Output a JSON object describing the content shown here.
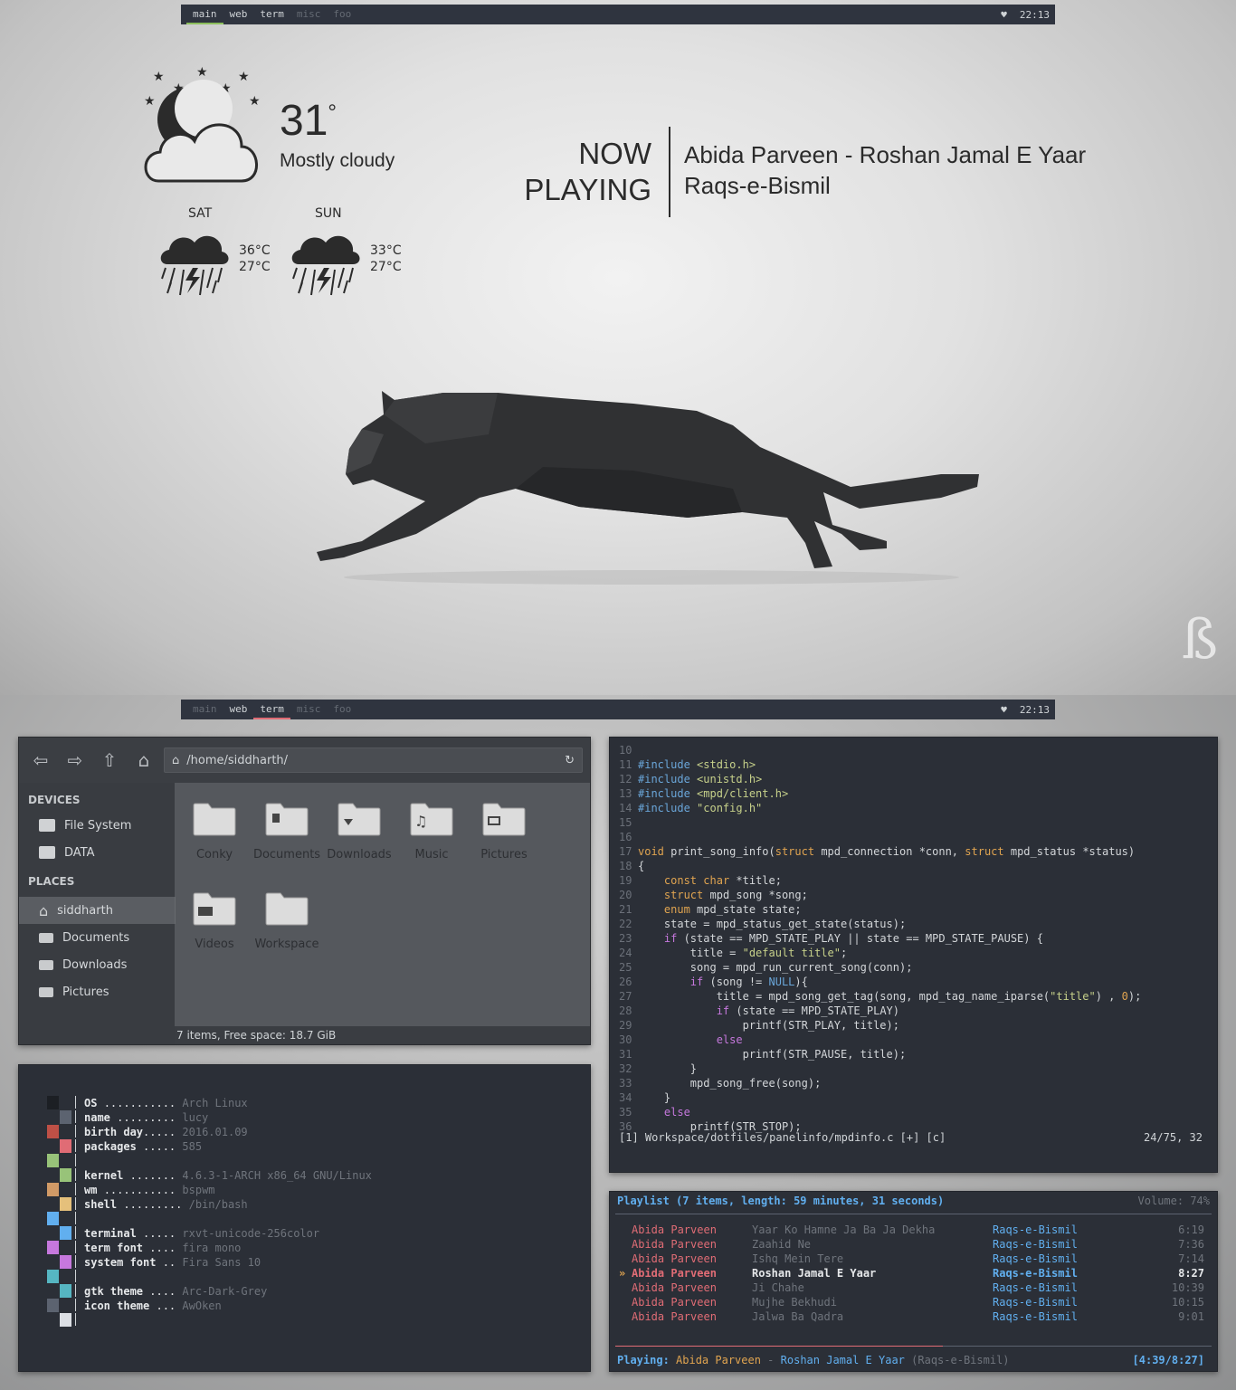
{
  "panel": {
    "workspaces": [
      "main",
      "web",
      "term",
      "misc",
      "foo"
    ],
    "heart_icon": "heart-icon",
    "clock": "22:13",
    "accent_main": "#8cbf5c",
    "accent_term": "#e06c75"
  },
  "weather": {
    "temp": "31",
    "degree": "°",
    "condition": "Mostly cloudy",
    "forecast": [
      {
        "day": "SAT",
        "high": "36°C",
        "low": "27°C",
        "icon": "storm-icon"
      },
      {
        "day": "SUN",
        "high": "33°C",
        "low": "27°C",
        "icon": "storm-icon"
      }
    ]
  },
  "now_playing": {
    "label_line1": "NOW",
    "label_line2": "PLAYING",
    "track": "Abida Parveen - Roshan Jamal E Yaar",
    "album": "Raqs-e-Bismil"
  },
  "file_manager": {
    "path": "/home/siddharth/",
    "devices_header": "DEVICES",
    "devices": [
      "File System",
      "DATA"
    ],
    "places_header": "PLACES",
    "places": [
      "siddharth",
      "Documents",
      "Downloads",
      "Pictures"
    ],
    "folders": [
      "Conky",
      "Documents",
      "Downloads",
      "Music",
      "Pictures",
      "Videos",
      "Workspace"
    ],
    "status": "7 items, Free space: 18.7 GiB"
  },
  "editor": {
    "lines": [
      {
        "n": "10",
        "t": ""
      },
      {
        "n": "11",
        "t": "#include <stdio.h>"
      },
      {
        "n": "12",
        "t": "#include <unistd.h>"
      },
      {
        "n": "13",
        "t": "#include <mpd/client.h>"
      },
      {
        "n": "14",
        "t": "#include \"config.h\""
      },
      {
        "n": "15",
        "t": ""
      },
      {
        "n": "16",
        "t": ""
      },
      {
        "n": "17",
        "t": "void print_song_info(struct mpd_connection *conn, struct mpd_status *status)"
      },
      {
        "n": "18",
        "t": "{"
      },
      {
        "n": "19",
        "t": "    const char *title;"
      },
      {
        "n": "20",
        "t": "    struct mpd_song *song;"
      },
      {
        "n": "21",
        "t": "    enum mpd_state state;"
      },
      {
        "n": "22",
        "t": "    state = mpd_status_get_state(status);"
      },
      {
        "n": "23",
        "t": "    if (state == MPD_STATE_PLAY || state == MPD_STATE_PAUSE) {"
      },
      {
        "n": "24",
        "t": "        title = \"default title\";"
      },
      {
        "n": "25",
        "t": "        song = mpd_run_current_song(conn);"
      },
      {
        "n": "26",
        "t": "        if (song != NULL){"
      },
      {
        "n": "27",
        "t": "            title = mpd_song_get_tag(song, mpd_tag_name_iparse(\"title\") , 0);"
      },
      {
        "n": "28",
        "t": "            if (state == MPD_STATE_PLAY)"
      },
      {
        "n": "29",
        "t": "                printf(STR_PLAY, title);"
      },
      {
        "n": "30",
        "t": "            else"
      },
      {
        "n": "31",
        "t": "                printf(STR_PAUSE, title);"
      },
      {
        "n": "32",
        "t": "        }"
      },
      {
        "n": "33",
        "t": "        mpd_song_free(song);"
      },
      {
        "n": "34",
        "t": "    }"
      },
      {
        "n": "35",
        "t": "    else"
      },
      {
        "n": "36",
        "t": "        printf(STR_STOP);"
      }
    ],
    "statusline_left": "[1] Workspace/dotfiles/panelinfo/mpdinfo.c [+] [c]",
    "statusline_right": "24/75, 32"
  },
  "sysinfo": {
    "rows": [
      {
        "k": "OS ",
        "dots": "........... ",
        "v": "Arch Linux",
        "line": 0
      },
      {
        "k": "name ",
        "dots": "......... ",
        "v": "lucy",
        "line": 1
      },
      {
        "k": "birth day",
        "dots": "..... ",
        "v": "2016.01.09",
        "line": 2
      },
      {
        "k": "packages ",
        "dots": "..... ",
        "v": "585",
        "line": 3
      },
      {
        "k": "kernel ",
        "dots": "....... ",
        "v": "4.6.3-1-ARCH x86_64 GNU/Linux",
        "line": 5
      },
      {
        "k": "wm ",
        "dots": "........... ",
        "v": "bspwm",
        "line": 6
      },
      {
        "k": "shell ",
        "dots": "......... ",
        "v": "/bin/bash",
        "line": 7
      },
      {
        "k": "terminal ",
        "dots": "..... ",
        "v": "rxvt-unicode-256color",
        "line": 9
      },
      {
        "k": "term font ",
        "dots": ".... ",
        "v": "fira mono",
        "line": 10
      },
      {
        "k": "system font ",
        "dots": ".. ",
        "v": "Fira Sans 10",
        "line": 11
      },
      {
        "k": "gtk theme ",
        "dots": ".... ",
        "v": "Arc-Dark-Grey",
        "line": 13
      },
      {
        "k": "icon theme ",
        "dots": "... ",
        "v": "AwOken",
        "line": 14
      }
    ],
    "palette": [
      "#1c1f24",
      "#5c6370",
      "#be5046",
      "#e06c75",
      "#98c379",
      "#98c379",
      "#d19a66",
      "#e5c07b",
      "#61afef",
      "#61afef",
      "#c678dd",
      "#c678dd",
      "#56b6c2",
      "#56b6c2",
      "#5c6370",
      "#dcdfe4"
    ]
  },
  "playlist": {
    "header": "Playlist (7 items, length: 59 minutes, 31 seconds)",
    "volume": "Volume: 74%",
    "items": [
      {
        "artist": "Abida Parveen",
        "title": "Yaar Ko Hamne Ja Ba Ja Dekha",
        "album": "Raqs-e-Bismil",
        "time": "6:19",
        "current": false
      },
      {
        "artist": "Abida Parveen",
        "title": "Zaahid Ne",
        "album": "Raqs-e-Bismil",
        "time": "7:36",
        "current": false
      },
      {
        "artist": "Abida Parveen",
        "title": "Ishq Mein Tere",
        "album": "Raqs-e-Bismil",
        "time": "7:14",
        "current": false
      },
      {
        "artist": "Abida Parveen",
        "title": "Roshan Jamal E Yaar",
        "album": "Raqs-e-Bismil",
        "time": "8:27",
        "current": true
      },
      {
        "artist": "Abida Parveen",
        "title": "Ji Chahe",
        "album": "Raqs-e-Bismil",
        "time": "10:39",
        "current": false
      },
      {
        "artist": "Abida Parveen",
        "title": "Mujhe Bekhudi",
        "album": "Raqs-e-Bismil",
        "time": "10:15",
        "current": false
      },
      {
        "artist": "Abida Parveen",
        "title": "Jalwa Ba Qadra",
        "album": "Raqs-e-Bismil",
        "time": "9:01",
        "current": false
      }
    ],
    "current_marker": "»",
    "progress": 0.55,
    "playing_label": "Playing:",
    "playing_artist": "Abida Parveen",
    "playing_sep": " - ",
    "playing_title": "Roshan Jamal E Yaar",
    "playing_album": "(Raqs-e-Bismil)",
    "playing_time": "[4:39/8:27]"
  }
}
